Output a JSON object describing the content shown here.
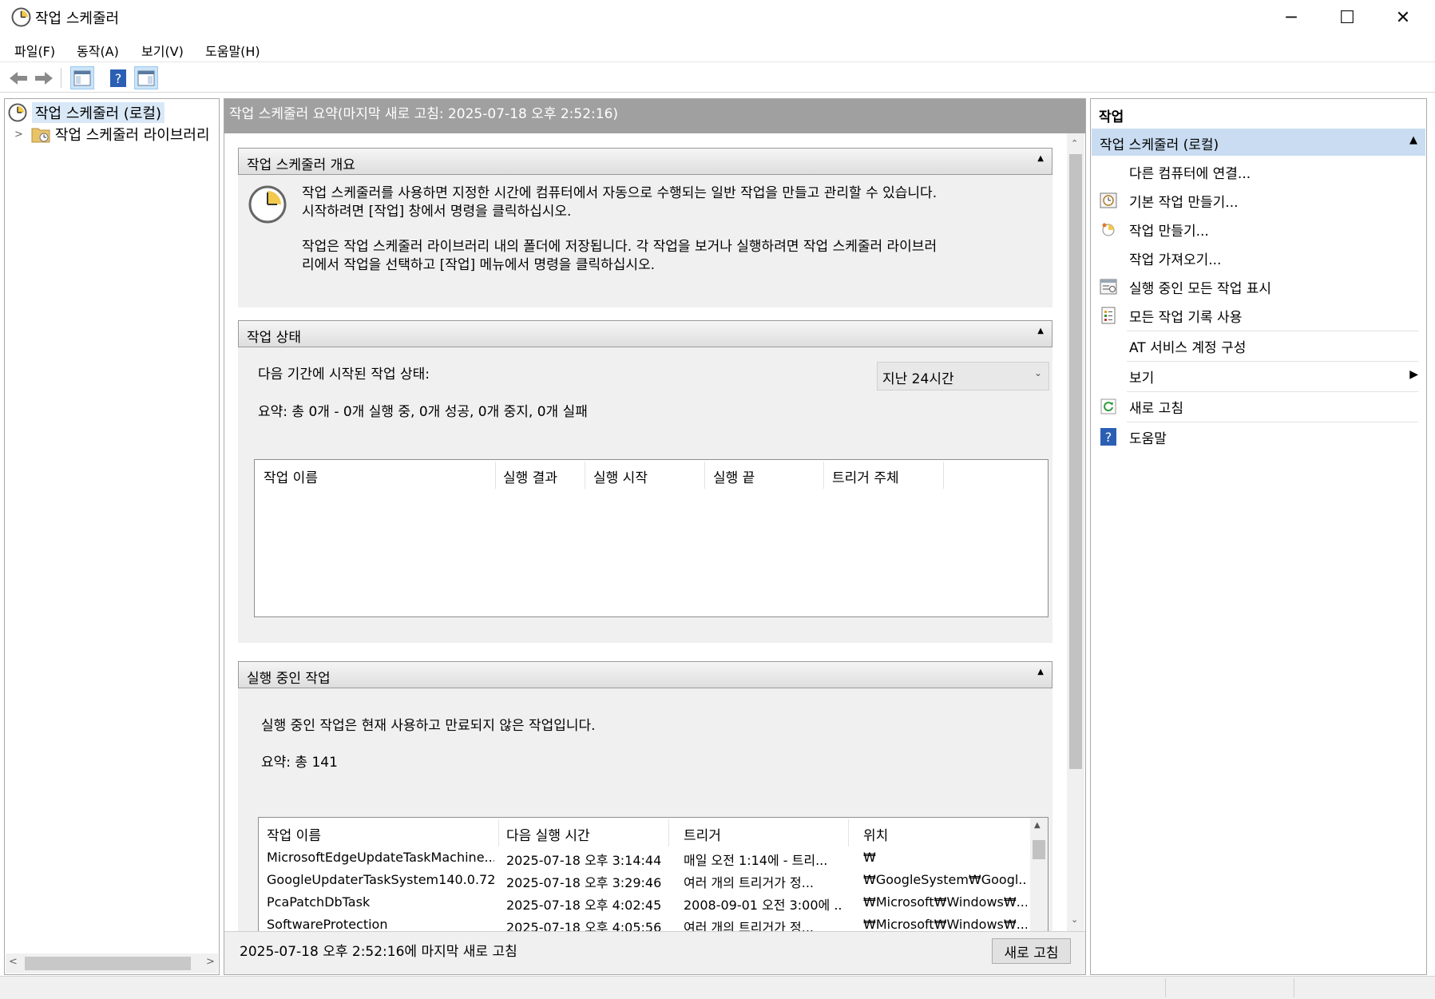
{
  "window": {
    "title": "작업 스케줄러"
  },
  "menu": [
    "파일(F)",
    "동작(A)",
    "보기(V)",
    "도움말(H)"
  ],
  "tree": {
    "root": "작업 스케줄러 (로컬)",
    "library": "작업 스케줄러 라이브러리"
  },
  "center": {
    "header": "작업 스케줄러 요약(마지막 새로 고침: 2025-07-18 오후 2:52:16)",
    "overview": {
      "title": "작업 스케줄러 개요",
      "line1": "작업 스케줄러를 사용하면 지정한 시간에 컴퓨터에서 자동으로 수행되는 일반 작업을 만들고 관리할 수 있습니다.",
      "line2": "시작하려면 [작업] 창에서 명령을 클릭하십시오.",
      "line3": "작업은 작업 스케줄러 라이브러리 내의 폴더에 저장됩니다. 각 작업을 보거나 실행하려면 작업 스케줄러 라이브러",
      "line4": "리에서 작업을 선택하고 [작업] 메뉴에서 명령을 클릭하십시오."
    },
    "status": {
      "title": "작업 상태",
      "period_label": "다음 기간에 시작된 작업 상태:",
      "period_value": "지난 24시간",
      "summary": "요약: 총 0개 - 0개 실행 중, 0개 성공, 0개 중지, 0개 실패",
      "columns": [
        "작업 이름",
        "실행 결과",
        "실행 시작",
        "실행 끝",
        "트리거 주체"
      ]
    },
    "running": {
      "title": "실행 중인 작업",
      "desc": "실행 중인 작업은 현재 사용하고 만료되지 않은 작업입니다.",
      "summary": "요약: 총 141",
      "columns": [
        "작업 이름",
        "다음 실행 시간",
        "트리거",
        "위치"
      ],
      "rows": [
        [
          "MicrosoftEdgeUpdateTaskMachine...",
          "2025-07-18 오후 3:14:44",
          "매일 오전 1:14에 - 트리...",
          "₩"
        ],
        [
          "GoogleUpdaterTaskSystem140.0.72...",
          "2025-07-18 오후 3:29:46",
          "여러 개의 트리거가 정...",
          "₩GoogleSystem₩Googl..."
        ],
        [
          "PcaPatchDbTask",
          "2025-07-18 오후 4:02:45",
          "2008-09-01 오전 3:00에 ...",
          "₩Microsoft₩Windows₩..."
        ],
        [
          "SoftwareProtection",
          "2025-07-18 오후 4:05:56",
          "여러 개의 트리거가 정...",
          "₩Microsoft₩Windows₩..."
        ]
      ]
    },
    "footer": {
      "refreshed": "2025-07-18 오후 2:52:16에 마지막 새로 고침",
      "refresh_button": "새로 고침"
    }
  },
  "actions": {
    "title": "작업",
    "group": "작업 스케줄러 (로컬)",
    "items": [
      {
        "label": "다른 컴퓨터에 연결...",
        "icon": "none"
      },
      {
        "label": "기본 작업 만들기...",
        "icon": "basic-task-icon"
      },
      {
        "label": "작업 만들기...",
        "icon": "create-task-icon"
      },
      {
        "label": "작업 가져오기...",
        "icon": "none"
      },
      {
        "label": "실행 중인 모든 작업 표시",
        "icon": "running-tasks-icon"
      },
      {
        "label": "모든 작업 기록 사용",
        "icon": "history-icon"
      },
      {
        "label": "AT 서비스 계정 구성",
        "icon": "none"
      },
      {
        "label": "보기",
        "icon": "none"
      },
      {
        "label": "새로 고침",
        "icon": "refresh-icon"
      },
      {
        "label": "도움말",
        "icon": "help-icon"
      }
    ]
  }
}
